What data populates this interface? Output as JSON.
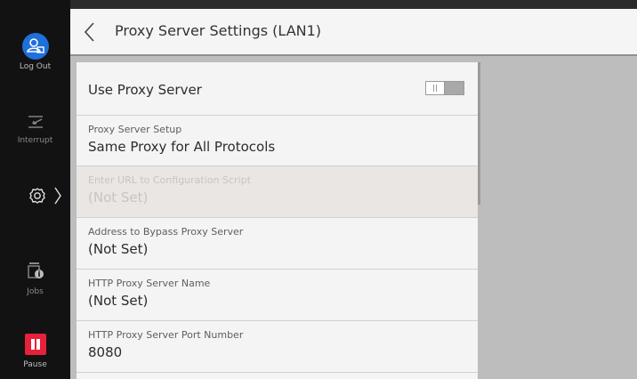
{
  "rail": {
    "logout_label": "Log Out",
    "interrupt_label": "Interrupt",
    "jobs_label": "Jobs",
    "pause_label": "Pause"
  },
  "header": {
    "title": "Proxy Server Settings (LAN1)"
  },
  "settings": {
    "use_proxy": {
      "label": "Use Proxy Server",
      "enabled": false
    },
    "rows": [
      {
        "label": "Proxy Server Setup",
        "value": "Same Proxy for All Protocols",
        "disabled": false
      },
      {
        "label": "Enter URL to Configuration Script",
        "value": "(Not Set)",
        "disabled": true
      },
      {
        "label": "Address to Bypass Proxy Server",
        "value": "(Not Set)",
        "disabled": false
      },
      {
        "label": "HTTP Proxy Server Name",
        "value": "(Not Set)",
        "disabled": false
      },
      {
        "label": "HTTP Proxy Server Port Number",
        "value": "8080",
        "disabled": false
      }
    ]
  },
  "colors": {
    "logout_accent": "#1f6fdc",
    "pause_accent": "#e8203a"
  },
  "icons": {
    "logout": "user-logout-icon",
    "interrupt": "interrupt-icon",
    "settings": "gear-icon",
    "jobs": "jobs-icon",
    "pause": "pause-icon",
    "back": "chevron-left-icon"
  }
}
